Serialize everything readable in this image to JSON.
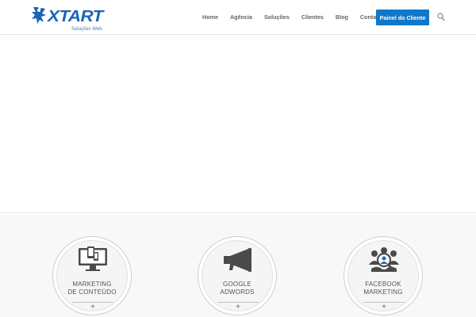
{
  "brand": {
    "name": "XTART",
    "subtitle": "Soluções Web"
  },
  "nav": {
    "items": [
      "Home",
      "Agência",
      "Soluções",
      "Clientes",
      "Blog",
      "Contato"
    ],
    "cta_label": "Painel do Cliente",
    "search_icon": "search-icon"
  },
  "colors": {
    "accent": "#1177c8",
    "brand": "#1b64b8",
    "nav_text": "#666666"
  },
  "services": [
    {
      "line1": "MARKETING",
      "line2": "DE CONTEÚDO",
      "icon": "devices-icon",
      "expand": "+"
    },
    {
      "line1": "GOOGLE",
      "line2": "ADWORDS",
      "icon": "megaphone-icon",
      "expand": "+"
    },
    {
      "line1": "FACEBOOK",
      "line2": "MARKETING",
      "icon": "audience-search-icon",
      "expand": "+"
    }
  ]
}
